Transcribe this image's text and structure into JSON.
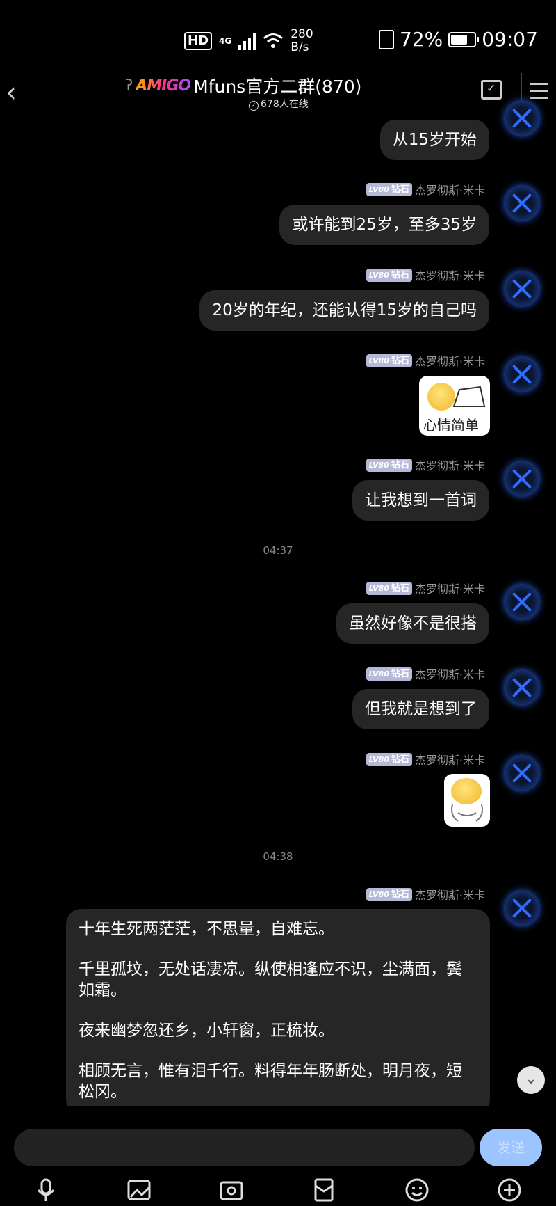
{
  "status_bar": {
    "hd": "HD",
    "network": "4G",
    "speed_value": "280",
    "speed_unit": "B/s",
    "battery_percent": "72%",
    "battery_level": 0.72,
    "time": "09:07"
  },
  "header": {
    "logo": "AMIGO",
    "title": "Mfuns官方二群(870)",
    "online": "678人在线"
  },
  "sender": {
    "level": "LV80",
    "rank": "钻石",
    "name": "杰罗彻斯·米卡"
  },
  "messages": {
    "m1": "从15岁开始",
    "m2": "或许能到25岁，至多35岁",
    "m3": "20岁的年纪，还能认得15岁的自己吗",
    "sticker1_text": "心情简单",
    "m4": "让我想到一首词",
    "time1": "04:37",
    "m5": "虽然好像不是很搭",
    "m6": "但我就是想到了",
    "time2": "04:38",
    "poem": [
      "十年生死两茫茫，不思量，自难忘。",
      "千里孤坟，无处话凄凉。纵使相逢应不识，尘满面，鬓如霜。",
      "夜来幽梦忽还乡，小轩窗，正梳妆。",
      "相顾无言，惟有泪千行。料得年年肠断处，明月夜，短松冈。"
    ]
  },
  "input": {
    "value": "",
    "send_label": "发送"
  },
  "toolbar_icons": [
    "microphone-icon",
    "image-icon",
    "camera-icon",
    "red-packet-icon",
    "emoji-icon",
    "plus-icon"
  ]
}
